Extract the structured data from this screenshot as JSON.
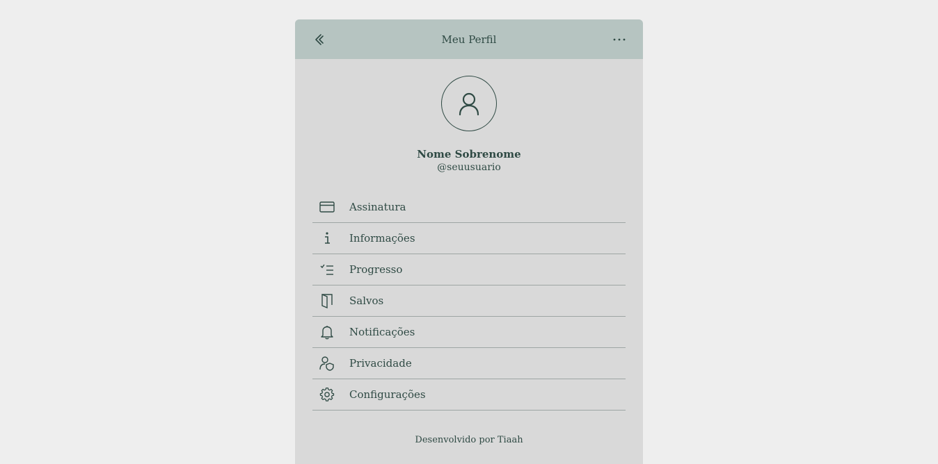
{
  "header": {
    "title": "Meu Perfil"
  },
  "profile": {
    "name": "Nome Sobrenome",
    "handle": "@seuusuario"
  },
  "menu": [
    {
      "label": "Assinatura",
      "icon": "credit-card-icon"
    },
    {
      "label": "Informações",
      "icon": "info-icon"
    },
    {
      "label": "Progresso",
      "icon": "checklist-icon"
    },
    {
      "label": "Salvos",
      "icon": "door-icon"
    },
    {
      "label": "Notificações",
      "icon": "bell-icon"
    },
    {
      "label": "Privacidade",
      "icon": "user-shield-icon"
    },
    {
      "label": "Configurações",
      "icon": "gear-icon"
    }
  ],
  "footer": {
    "text": "Desenvolvido por Tiaah"
  },
  "colors": {
    "background": "#eeeeee",
    "card": "#d9d9d9",
    "header": "#b6c4c1",
    "accent": "#2f4a44"
  }
}
